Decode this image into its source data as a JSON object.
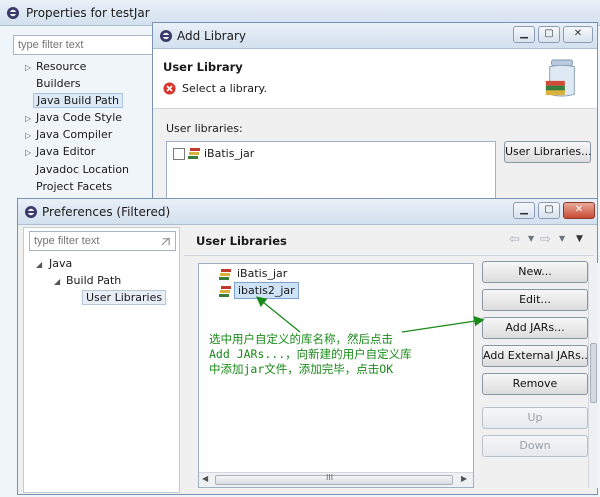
{
  "props_window": {
    "title": "Properties for testJar",
    "filter_placeholder": "type filter text",
    "tree": [
      {
        "label": "Resource",
        "expandable": true
      },
      {
        "label": "Builders",
        "expandable": false
      },
      {
        "label": "Java Build Path",
        "expandable": false,
        "selected": true
      },
      {
        "label": "Java Code Style",
        "expandable": true
      },
      {
        "label": "Java Compiler",
        "expandable": true
      },
      {
        "label": "Java Editor",
        "expandable": true
      },
      {
        "label": "Javadoc Location",
        "expandable": false
      },
      {
        "label": "Project Facets",
        "expandable": false
      }
    ]
  },
  "add_library": {
    "title": "Add Library",
    "section_title": "User Library",
    "message": "Select a library.",
    "list_label": "User libraries:",
    "libraries": [
      {
        "label": "iBatis_jar",
        "checked": false
      }
    ],
    "user_libraries_button": "User Libraries..."
  },
  "preferences": {
    "title": "Preferences (Filtered)",
    "filter_placeholder": "type filter text",
    "tree": {
      "root": "Java",
      "child": "Build Path",
      "leaf": "User Libraries"
    },
    "page_title": "User Libraries",
    "libraries": [
      "iBatis_jar",
      "ibatis2_jar"
    ],
    "buttons": {
      "new": "New...",
      "edit": "Edit...",
      "add_jars": "Add JARs...",
      "add_external_jars": "Add External JARs...",
      "remove": "Remove",
      "up": "Up",
      "down": "Down"
    },
    "scroll_grip": "III"
  },
  "annotation": {
    "lines": [
      "选中用户自定义的库名称，然后点击",
      "Add JARs...，向新建的用户自定义库",
      "中添加jar文件，添加完毕，点击OK"
    ]
  },
  "colors": {
    "annotation": "#1a8a1a",
    "error_icon": "#d9342b",
    "selection": "#cfe3f7"
  }
}
